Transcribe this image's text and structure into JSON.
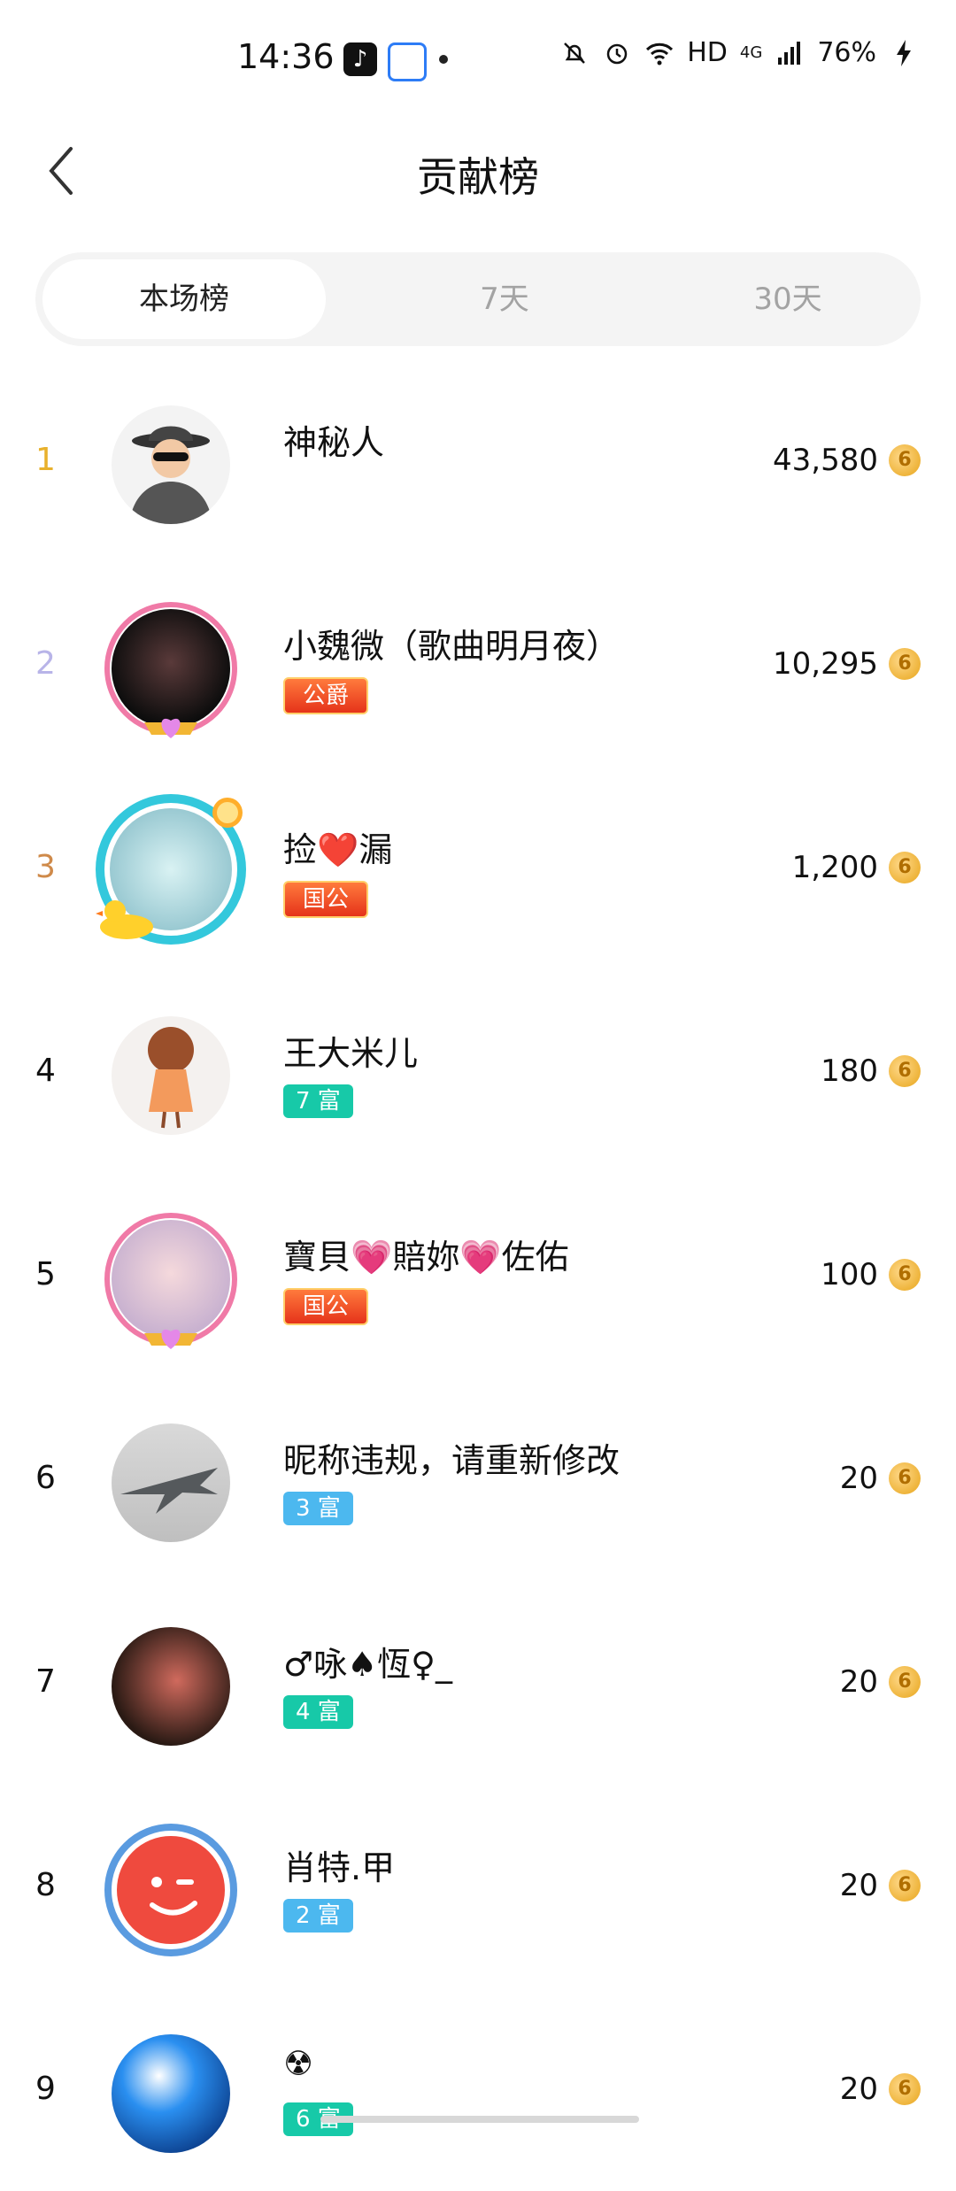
{
  "status_bar": {
    "time": "14:36",
    "tiktok_glyph": "♪",
    "network": "HD",
    "cell": "4G",
    "battery": "76%"
  },
  "header": {
    "title": "贡献榜"
  },
  "tabs": [
    {
      "label": "本场榜",
      "active": true
    },
    {
      "label": "7天",
      "active": false
    },
    {
      "label": "30天",
      "active": false
    }
  ],
  "coin_glyph": "6",
  "entries": [
    {
      "rank": "1",
      "name": "神秘人",
      "badge": "",
      "amount": "43,580"
    },
    {
      "rank": "2",
      "name": "小魏微（歌曲明月夜）",
      "badge": "公爵",
      "amount": "10,295"
    },
    {
      "rank": "3",
      "name": "捡❤️漏",
      "badge": "国公",
      "amount": "1,200"
    },
    {
      "rank": "4",
      "name": "王大米儿",
      "badge": "7 富",
      "amount": "180"
    },
    {
      "rank": "5",
      "name": "寶貝💗賠妳💗佐佑",
      "badge": "国公",
      "amount": "100"
    },
    {
      "rank": "6",
      "name": "昵称违规，请重新修改",
      "badge": "3 富",
      "amount": "20"
    },
    {
      "rank": "7",
      "name": "♂咏♠恆♀_",
      "badge": "4 富",
      "amount": "20"
    },
    {
      "rank": "8",
      "name": "肖特.甲",
      "badge": "2 富",
      "amount": "20"
    },
    {
      "rank": "9",
      "name": "☢︎",
      "badge": "6 富",
      "amount": "20"
    }
  ],
  "colors": {
    "rank1": "#e8b12c",
    "rank2": "#b8b4e8",
    "rank3": "#cf8a4a",
    "rich_teal": "#17c9a8",
    "rich_blue": "#4cb8ef",
    "noble_red": "#e5331a"
  }
}
